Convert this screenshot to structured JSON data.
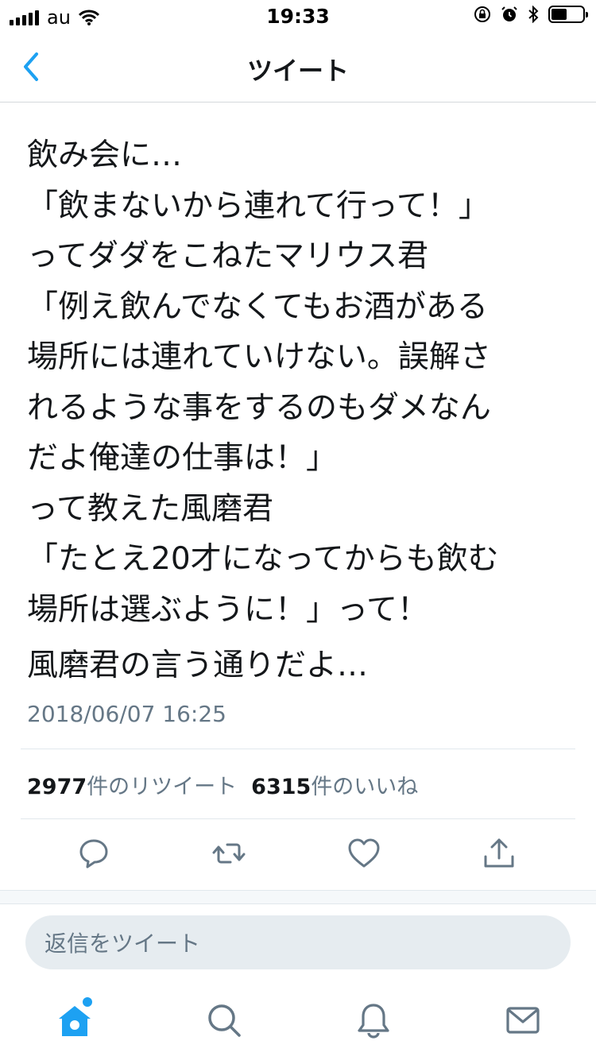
{
  "status_bar": {
    "carrier": "au",
    "time": "19:33"
  },
  "header": {
    "title": "ツイート",
    "icons": [
      "back-chevron-icon"
    ]
  },
  "tweet": {
    "text": "飲み会に…\n「飲まないから連れて行って！」\nってダダをこねたマリウス君\n「例え飲んでなくてもお酒がある\n場所には連れていけない。誤解さ\nれるような事をするのもダメなん\nだよ俺達の仕事は！」\nって教えた風磨君\n「たとえ20才になってからも飲む\n場所は選ぶように！」って！",
    "text_last": "風磨君の言う通りだよ…",
    "timestamp": "2018/06/07 16:25",
    "retweet_count": "2977",
    "retweet_label": "件のリツイート",
    "like_count": "6315",
    "like_label": "件のいいね"
  },
  "actions": {
    "icons": [
      "reply-icon",
      "retweet-icon",
      "like-icon",
      "share-icon"
    ]
  },
  "reply": {
    "placeholder": "返信をツイート"
  },
  "tab_bar": {
    "icons": [
      "home-icon",
      "search-icon",
      "notifications-icon",
      "messages-icon"
    ]
  },
  "colors": {
    "accent": "#1da1f2",
    "text_primary": "#14171a",
    "text_secondary": "#657786",
    "divider": "#e1e8ed"
  }
}
